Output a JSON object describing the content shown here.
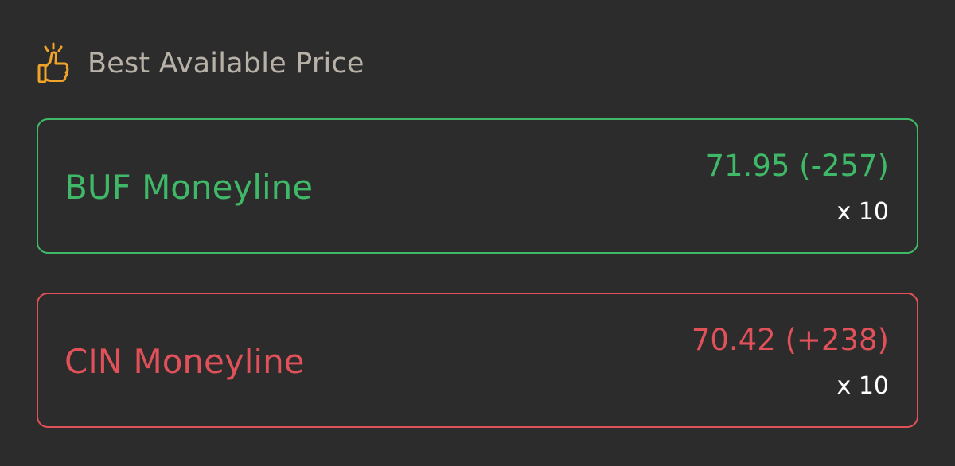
{
  "header": {
    "icon": "thumbs-up-icon",
    "title": "Best Available Price",
    "icon_color": "#f0a42a"
  },
  "markets": [
    {
      "label": "BUF Moneyline",
      "price": "71.95 (-257)",
      "quantity": "x 10",
      "color": "#3fb867"
    },
    {
      "label": "CIN Moneyline",
      "price": "70.42 (+238)",
      "quantity": "x 10",
      "color": "#e05159"
    }
  ]
}
